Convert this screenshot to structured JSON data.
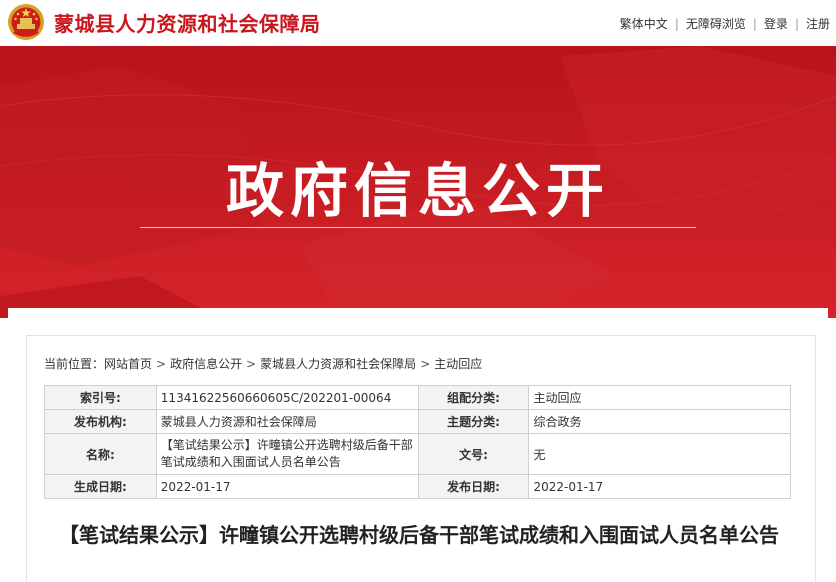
{
  "header": {
    "site_name": "蒙城县人力资源和社会保障局",
    "links": [
      "繁体中文",
      "无障碍浏览",
      "登录",
      "注册"
    ]
  },
  "banner": {
    "title": "政府信息公开"
  },
  "breadcrumb": {
    "prefix": "当前位置：",
    "items": [
      "网站首页",
      "政府信息公开",
      "蒙城县人力资源和社会保障局",
      "主动回应"
    ],
    "separator": ">"
  },
  "meta": {
    "index_label": "索引号:",
    "index_value": "11341622560660605C/202201-00064",
    "category_label": "组配分类:",
    "category_value": "主动回应",
    "publisher_label": "发布机构:",
    "publisher_value": "蒙城县人力资源和社会保障局",
    "topic_label": "主题分类:",
    "topic_value": "综合政务",
    "name_label": "名称:",
    "name_value": "【笔试结果公示】许疃镇公开选聘村级后备干部笔试成绩和入围面试人员名单公告",
    "docno_label": "文号:",
    "docno_value": "无",
    "created_label": "生成日期:",
    "created_value": "2022-01-17",
    "published_label": "发布日期:",
    "published_value": "2022-01-17"
  },
  "article": {
    "title": "【笔试结果公示】许疃镇公开选聘村级后备干部笔试成绩和入围面试人员名单公告"
  },
  "colors": {
    "brand_red": "#c8161d",
    "banner_red": "#c41a20"
  },
  "icons": {
    "emblem": "national-emblem-icon"
  }
}
